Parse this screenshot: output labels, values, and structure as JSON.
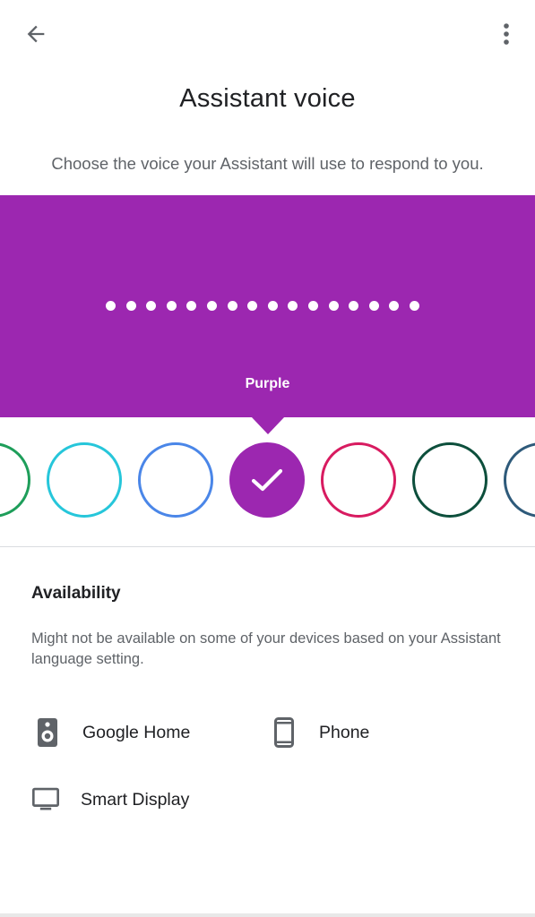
{
  "header": {
    "back_icon": "arrow-back-icon",
    "more_icon": "more-vert-icon"
  },
  "page": {
    "title": "Assistant voice",
    "subtitle": "Choose the voice your Assistant will use to respond to you."
  },
  "preview": {
    "background_color": "#9c27b0",
    "selected_voice_name": "Purple",
    "dot_count": 16
  },
  "voices": [
    {
      "color": "#1e9e5a",
      "selected": false
    },
    {
      "color": "#26c6da",
      "selected": false
    },
    {
      "color": "#4a86e8",
      "selected": false
    },
    {
      "color": "#9c27b0",
      "selected": true
    },
    {
      "color": "#d81b60",
      "selected": false
    },
    {
      "color": "#0d4f3c",
      "selected": false
    },
    {
      "color": "#2e5a7a",
      "selected": false
    }
  ],
  "availability": {
    "heading": "Availability",
    "description": "Might not be available on some of your devices based on your Assistant language setting.",
    "devices": [
      {
        "label": "Google Home",
        "icon": "speaker-icon"
      },
      {
        "label": "Phone",
        "icon": "phone-icon"
      },
      {
        "label": "Smart Display",
        "icon": "monitor-icon"
      }
    ]
  }
}
